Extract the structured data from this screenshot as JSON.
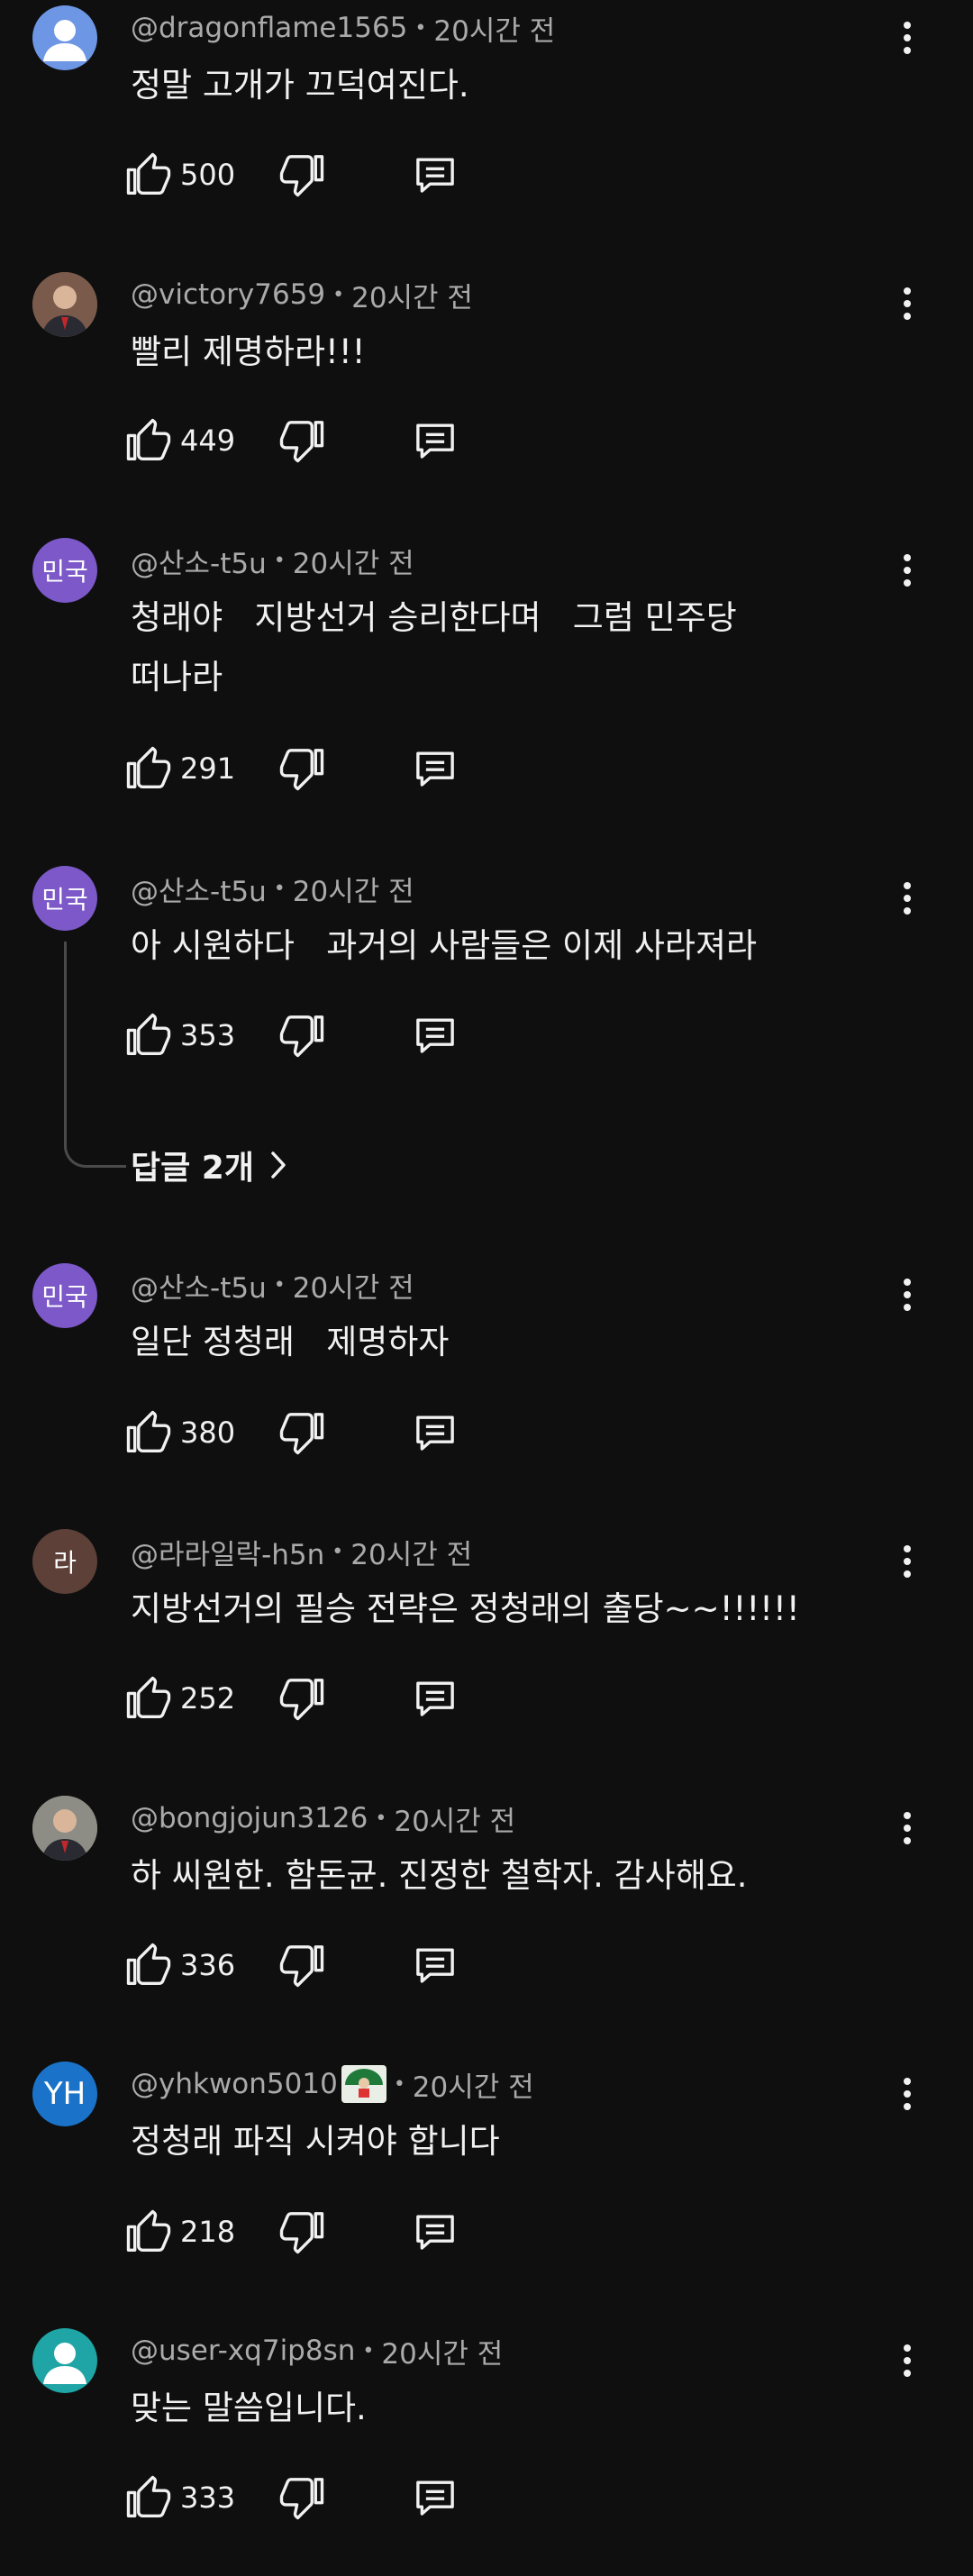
{
  "labels": {
    "dot": "•"
  },
  "comments": [
    {
      "handle": "@dragonflame1565",
      "time": "20시간 전",
      "text": "정말 고개가 끄덕여진다.",
      "likes": "500",
      "avatar": {
        "type": "default-person",
        "color": "#6d96e4"
      }
    },
    {
      "handle": "@victory7659",
      "time": "20시간 전",
      "text": "빨리 제명하라!!!",
      "likes": "449",
      "avatar": {
        "type": "photo",
        "color": "#7a5a4a"
      }
    },
    {
      "handle": "@산소-t5u",
      "time": "20시간 전",
      "text": "청래야   지방선거 승리한다며   그럼 민주당\n떠나라",
      "likes": "291",
      "avatar": {
        "type": "text",
        "label": "민국",
        "color": "#7c58c8"
      }
    },
    {
      "handle": "@산소-t5u",
      "time": "20시간 전",
      "text": "아 시원하다   과거의 사람들은 이제 사라져라",
      "likes": "353",
      "avatar": {
        "type": "text",
        "label": "민국",
        "color": "#7c58c8"
      },
      "replies_label": "답글 2개"
    },
    {
      "handle": "@산소-t5u",
      "time": "20시간 전",
      "text": "일단 정청래   제명하자",
      "likes": "380",
      "avatar": {
        "type": "text",
        "label": "민국",
        "color": "#7c58c8"
      }
    },
    {
      "handle": "@라라일락-h5n",
      "time": "20시간 전",
      "text": "지방선거의 필승 전략은 정청래의 출당~~!!!!!!",
      "likes": "252",
      "avatar": {
        "type": "text",
        "label": "라",
        "color": "#5d4037"
      }
    },
    {
      "handle": "@bongjojun3126",
      "time": "20시간 전",
      "text": "하 씨원한. 함돈균. 진정한 철학자. 감사해요.",
      "likes": "336",
      "avatar": {
        "type": "photo",
        "color": "#8d8d86"
      }
    },
    {
      "handle": "@yhkwon5010",
      "time": "20시간 전",
      "text": "정청래 파직 시켜야 합니다",
      "likes": "218",
      "avatar": {
        "type": "text",
        "label": "YH",
        "color": "#1a73c8"
      },
      "badge": "member-badge-icon"
    },
    {
      "handle": "@user-xq7ip8sn",
      "time": "20시간 전",
      "text": "맞는 말씀입니다.",
      "likes": "333",
      "avatar": {
        "type": "default-person",
        "color": "#1fa5a5"
      }
    }
  ]
}
